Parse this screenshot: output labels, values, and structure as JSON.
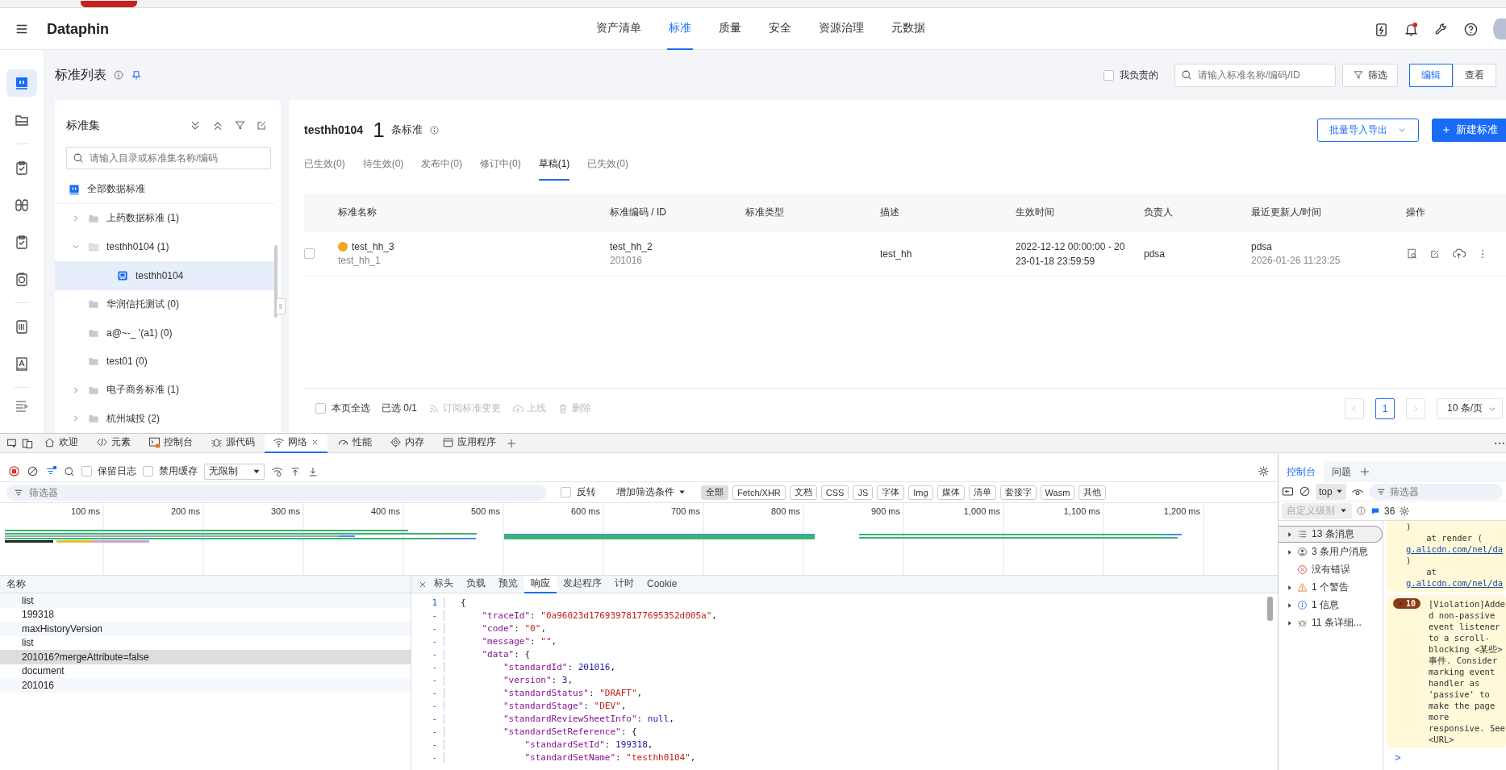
{
  "header": {
    "logo": "Dataphin",
    "nav": [
      {
        "label": "资产清单",
        "selected": false
      },
      {
        "label": "标准",
        "selected": true
      },
      {
        "label": "质量",
        "selected": false
      },
      {
        "label": "安全",
        "selected": false
      },
      {
        "label": "资源治理",
        "selected": false
      },
      {
        "label": "元数据",
        "selected": false
      }
    ]
  },
  "rail": [
    {
      "selected": true
    },
    {
      "selected": false
    },
    {
      "selected": false
    },
    {
      "selected": false
    },
    {
      "selected": false
    },
    {
      "selected": false
    },
    {
      "selected": false
    },
    {
      "selected": false
    }
  ],
  "page": {
    "title": "标准列表",
    "mine": {
      "label": "我负责的",
      "checked": false
    },
    "search": {
      "placeholder": "请输入标准名称/编码/ID"
    },
    "filter_button": "筛选",
    "mode": [
      {
        "label": "编辑",
        "selected": true
      },
      {
        "label": "查看",
        "selected": false
      }
    ]
  },
  "tree": {
    "title": "标准集",
    "search": {
      "placeholder": "请输入目录或标准集名称/编码"
    },
    "root": "全部数据标准",
    "items": [
      {
        "kind": "group",
        "label": "上药数据标准 (1)",
        "expanded": false,
        "selected": false
      },
      {
        "kind": "group",
        "label": "testhh0104 (1)",
        "expanded": true,
        "selected": false,
        "children": [
          {
            "kind": "set",
            "label": "testhh0104",
            "selected": true
          }
        ]
      },
      {
        "kind": "folder",
        "label": "华润信托测试 (0)",
        "selected": false
      },
      {
        "kind": "folder",
        "label": "a@~-_ '(a1) (0)",
        "selected": false
      },
      {
        "kind": "folder",
        "label": "test01 (0)",
        "selected": false
      },
      {
        "kind": "group",
        "label": "电子商务标准 (1)",
        "expanded": false,
        "selected": false
      },
      {
        "kind": "group",
        "label": "杭州城投 (2)",
        "expanded": false,
        "selected": false
      }
    ]
  },
  "main": {
    "title": "testhh0104",
    "count": "1",
    "count_unit": "条标准",
    "import_button": "批量导入导出",
    "new_button": "新建标准",
    "tabs": [
      {
        "label": "已生效(0)",
        "selected": false
      },
      {
        "label": "待生效(0)",
        "selected": false
      },
      {
        "label": "发布中(0)",
        "selected": false
      },
      {
        "label": "修订中(0)",
        "selected": false
      },
      {
        "label": "草稿(1)",
        "selected": true
      },
      {
        "label": "已失效(0)",
        "selected": false
      }
    ],
    "table": {
      "columns": [
        "标准名称",
        "标准编码 / ID",
        "标准类型",
        "描述",
        "生效时间",
        "负责人",
        "最近更新人/时间",
        "操作"
      ],
      "rows": [
        {
          "checked": false,
          "color": "#f5a623",
          "name": "test_hh_3",
          "subname": "test_hh_1",
          "code": "test_hh_2",
          "id": "201016",
          "description": "test_hh",
          "effective_time": "2022-12-12 00:00:00 - 2023-01-18 23:59:59",
          "owner": "pdsa",
          "updater": "pdsa",
          "updated_at": "2026-01-26 11:23:25"
        }
      ]
    },
    "footer": {
      "select_all": {
        "label": "本页全选",
        "checked": false
      },
      "selected_count": "已选 0/1",
      "actions": [
        {
          "label": "订阅标准变更",
          "disabled": true
        },
        {
          "label": "上线",
          "disabled": true
        },
        {
          "label": "删除",
          "disabled": true
        }
      ],
      "pages": [
        {
          "label": "1",
          "selected": true
        }
      ],
      "page_size": "10 条/页"
    }
  },
  "devtools": {
    "tabs": [
      {
        "label": "欢迎",
        "selected": false
      },
      {
        "label": "元素",
        "selected": false
      },
      {
        "label": "控制台",
        "selected": false
      },
      {
        "label": "源代码",
        "selected": false
      },
      {
        "label": "网络",
        "selected": true
      },
      {
        "label": "性能",
        "selected": false
      },
      {
        "label": "内存",
        "selected": false
      },
      {
        "label": "应用程序",
        "selected": false
      }
    ],
    "network": {
      "preserve_log": {
        "label": "保留日志",
        "checked": false
      },
      "disable_cache": {
        "label": "禁用缓存",
        "checked": false
      },
      "throttle": "无限制",
      "filter_placeholder": "筛选器",
      "invert": {
        "label": "反转",
        "checked": false
      },
      "more_filters": "增加筛选条件",
      "types": [
        {
          "label": "全部",
          "selected": true
        },
        {
          "label": "Fetch/XHR",
          "selected": false
        },
        {
          "label": "文档",
          "selected": false
        },
        {
          "label": "CSS",
          "selected": false
        },
        {
          "label": "JS",
          "selected": false
        },
        {
          "label": "字体",
          "selected": false
        },
        {
          "label": "Img",
          "selected": false
        },
        {
          "label": "媒体",
          "selected": false
        },
        {
          "label": "清单",
          "selected": false
        },
        {
          "label": "套接字",
          "selected": false
        },
        {
          "label": "Wasm",
          "selected": false
        },
        {
          "label": "其他",
          "selected": false
        }
      ],
      "ticks": [
        "100 ms",
        "200 ms",
        "300 ms",
        "400 ms",
        "500 ms",
        "600 ms",
        "700 ms",
        "800 ms",
        "900 ms",
        "1,000 ms",
        "1,100 ms",
        "1,200 ms"
      ],
      "requests_header": "名称",
      "requests": [
        {
          "name": "list",
          "selected": false
        },
        {
          "name": "199318",
          "selected": false
        },
        {
          "name": "maxHistoryVersion",
          "selected": false
        },
        {
          "name": "list",
          "selected": false
        },
        {
          "name": "201016?mergeAttribute=false",
          "selected": true
        },
        {
          "name": "document",
          "selected": false
        },
        {
          "name": "201016",
          "selected": false
        }
      ],
      "detail_tabs": [
        {
          "label": "标头",
          "selected": false
        },
        {
          "label": "负载",
          "selected": false
        },
        {
          "label": "预览",
          "selected": false
        },
        {
          "label": "响应",
          "selected": true
        },
        {
          "label": "发起程序",
          "selected": false
        },
        {
          "label": "计时",
          "selected": false
        },
        {
          "label": "Cookie",
          "selected": false
        }
      ],
      "code": [
        {
          "gutter": "1",
          "text": "{"
        },
        {
          "gutter": "-",
          "text": "    \"traceId\": \"0a96023d17693978177695352d005a\","
        },
        {
          "gutter": "-",
          "text": "    \"code\": \"0\","
        },
        {
          "gutter": "-",
          "text": "    \"message\": \"\","
        },
        {
          "gutter": "-",
          "text": "    \"data\": {"
        },
        {
          "gutter": "-",
          "text": "        \"standardId\": 201016,"
        },
        {
          "gutter": "-",
          "text": "        \"version\": 3,"
        },
        {
          "gutter": "-",
          "text": "        \"standardStatus\": \"DRAFT\","
        },
        {
          "gutter": "-",
          "text": "        \"standardStage\": \"DEV\","
        },
        {
          "gutter": "-",
          "text": "        \"standardReviewSheetInfo\": null,"
        },
        {
          "gutter": "-",
          "text": "        \"standardSetReference\": {"
        },
        {
          "gutter": "-",
          "text": "            \"standardSetId\": 199318,"
        },
        {
          "gutter": "-",
          "text": "            \"standardSetName\": \"testhh0104\","
        }
      ]
    },
    "console": {
      "tabs": [
        {
          "label": "控制台",
          "selected": true
        },
        {
          "label": "问题",
          "selected": false
        }
      ],
      "context": "top",
      "filter_placeholder": "筛选器",
      "level": "自定义级别",
      "badge": "36",
      "groups": [
        {
          "kind": "all",
          "label": "13 条消息",
          "selected": true,
          "expandable": true
        },
        {
          "kind": "user",
          "label": "3 条用户消息",
          "selected": false,
          "expandable": true
        },
        {
          "kind": "error",
          "label": "没有错误",
          "selected": false,
          "expandable": false
        },
        {
          "kind": "warning",
          "label": "1 个警告",
          "selected": false,
          "expandable": true
        },
        {
          "kind": "info",
          "label": "1 信息",
          "selected": false,
          "expandable": true
        },
        {
          "kind": "verbose",
          "label": "11 条详细...",
          "selected": false,
          "expandable": true
        }
      ],
      "messages": [
        {
          "lines": [
            {
              "kind": "text",
              "text": ")"
            },
            {
              "kind": "text",
              "text": "    at render ("
            },
            {
              "kind": "link",
              "text": "g.alicdn.com/nel/da"
            },
            {
              "kind": "text",
              "text": ")"
            },
            {
              "kind": "text",
              "text": "    at"
            },
            {
              "kind": "link",
              "text": "g.alicdn.com/nel/da"
            }
          ]
        },
        {
          "count": "10",
          "lines": [
            {
              "kind": "text",
              "text": "[Violation]Added non-passive event listener to a scroll-blocking <某些> 事件. Consider marking event handler as 'passive' to make the page more responsive. See <URL>"
            }
          ]
        }
      ],
      "prompt": ">"
    }
  }
}
